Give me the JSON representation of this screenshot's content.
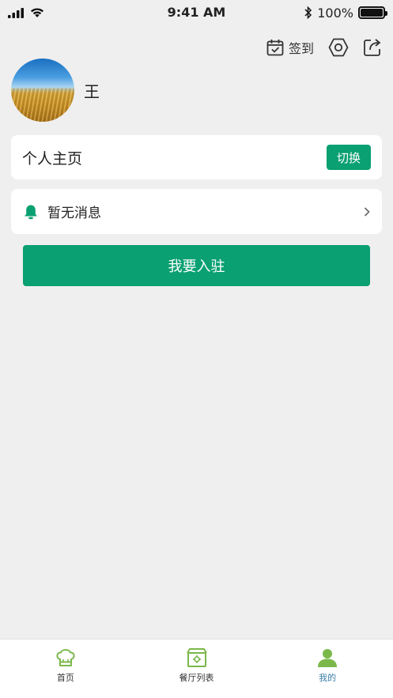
{
  "status_bar": {
    "time": "9:41 AM",
    "battery_text": "100%"
  },
  "top_actions": {
    "sign_in_label": "签到"
  },
  "profile": {
    "name": "王"
  },
  "home_card": {
    "title": "个人主页",
    "switch_label": "切换"
  },
  "message_card": {
    "text": "暂无消息"
  },
  "join_button": {
    "label": "我要入驻"
  },
  "tab_bar": {
    "tabs": [
      {
        "label": "首页",
        "icon": "chef-hat-icon"
      },
      {
        "label": "餐厅列表",
        "icon": "restaurant-icon"
      },
      {
        "label": "我的",
        "icon": "person-icon"
      }
    ],
    "active_index": 2
  },
  "colors": {
    "accent": "#0aa071",
    "tab_icon": "#7bb84a",
    "active_tab_text": "#3b7ea8",
    "background": "#efefef"
  }
}
